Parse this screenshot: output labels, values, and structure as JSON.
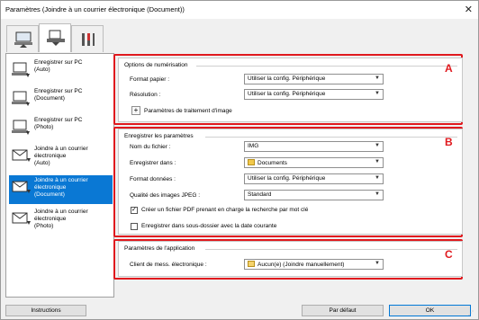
{
  "window": {
    "title": "Paramètres (Joindre à un courrier électronique (Document))",
    "close_icon": "close-icon"
  },
  "tabs": [
    {
      "name": "scan-from-computer",
      "icon": "computer-scan-icon"
    },
    {
      "name": "scan-from-device",
      "icon": "scanner-icon"
    },
    {
      "name": "general-settings",
      "icon": "tools-icon"
    }
  ],
  "sidebar": {
    "items": [
      {
        "label": "Enregistrer sur PC\n(Auto)",
        "icon": "pc-save-icon"
      },
      {
        "label": "Enregistrer sur PC\n(Document)",
        "icon": "pc-save-icon"
      },
      {
        "label": "Enregistrer sur PC\n(Photo)",
        "icon": "pc-save-icon"
      },
      {
        "label": "Joindre à un courrier\nélectronique\n(Auto)",
        "icon": "mail-attach-icon"
      },
      {
        "label": "Joindre à un courrier\nélectronique\n(Document)",
        "icon": "mail-attach-icon"
      },
      {
        "label": "Joindre à un courrier\nélectronique\n(Photo)",
        "icon": "mail-attach-icon"
      }
    ],
    "selected_index": 4
  },
  "scan_options": {
    "title": "Options de numérisation",
    "badge": "A",
    "paper_size_label": "Format papier :",
    "paper_size_value": "Utiliser la config. Périphérique",
    "resolution_label": "Résolution :",
    "resolution_value": "Utiliser la config. Périphérique",
    "image_processing_label": "Paramètres de traitement d'image"
  },
  "save_settings": {
    "title": "Enregistrer les paramètres",
    "badge": "B",
    "filename_label": "Nom du fichier :",
    "filename_value": "IMG",
    "save_in_label": "Enregistrer dans :",
    "save_in_value": "Documents",
    "data_format_label": "Format données :",
    "data_format_value": "Utiliser la config. Périphérique",
    "jpeg_quality_label": "Qualité des images JPEG :",
    "jpeg_quality_value": "Standard",
    "keyword_pdf_label": "Créer un fichier PDF prenant en charge la recherche par mot clé",
    "keyword_pdf_checked": true,
    "subfolder_label": "Enregistrer dans sous-dossier avec la date courante",
    "subfolder_checked": false
  },
  "app_settings": {
    "title": "Paramètres de l'application",
    "badge": "C",
    "mail_client_label": "Client de mess. électronique :",
    "mail_client_value": "Aucun(e) (Joindre manuellement)"
  },
  "footer": {
    "instructions_label": "Instructions",
    "default_label": "Par défaut",
    "ok_label": "OK"
  },
  "colors": {
    "accent": "#0a78d4",
    "highlight": "#e0191e"
  }
}
